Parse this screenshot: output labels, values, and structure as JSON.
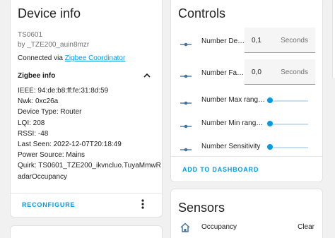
{
  "device_card": {
    "title": "Device info",
    "model": "TS0601",
    "manufacturer": "by _TZE200_auin8mzr",
    "connected_prefix": "Connected via ",
    "connected_link": "Zigbee Coordinator",
    "zigbee_header": "Zigbee info",
    "zigbee_lines": [
      "IEEE: 94:de:b8:ff:fe:31:8d:59",
      "Nwk: 0xc26a",
      "Device Type: Router",
      "LQI: 208",
      "RSSI: -48",
      "Last Seen: 2022-12-07T20:18:49",
      "Power Source: Mains",
      "Quirk: TS0601_TZE200_ikvncluo.TuyaMmwR",
      "adarOccupancy"
    ],
    "reconfigure_label": "RECONFIGURE",
    "overflow_icon": "dots-vertical-icon",
    "collapse_icon": "chevron-up-icon"
  },
  "controls_card": {
    "title": "Controls",
    "number_fields": [
      {
        "label": "Number De…",
        "value": "0,1",
        "unit": "Seconds"
      },
      {
        "label": "Number Fa…",
        "value": "0,0",
        "unit": "Seconds"
      }
    ],
    "sliders": [
      {
        "label": "Number Max rang…",
        "level": 0
      },
      {
        "label": "Number Min rang…",
        "level": 0
      },
      {
        "label": "Number Sensitivity",
        "level": 0
      }
    ],
    "row_icon": "ray-vertex-icon",
    "add_to_dashboard_label": "ADD TO DASHBOARD"
  },
  "sensors_card": {
    "title": "Sensors",
    "rows": [
      {
        "label": "Occupancy",
        "state": "Clear",
        "icon": "home-outline-icon"
      }
    ]
  },
  "colors": {
    "accent": "#039be5",
    "text": "#212121",
    "secondary_text": "#727272",
    "background": "#f1f1f1",
    "icon": "#44739e"
  }
}
